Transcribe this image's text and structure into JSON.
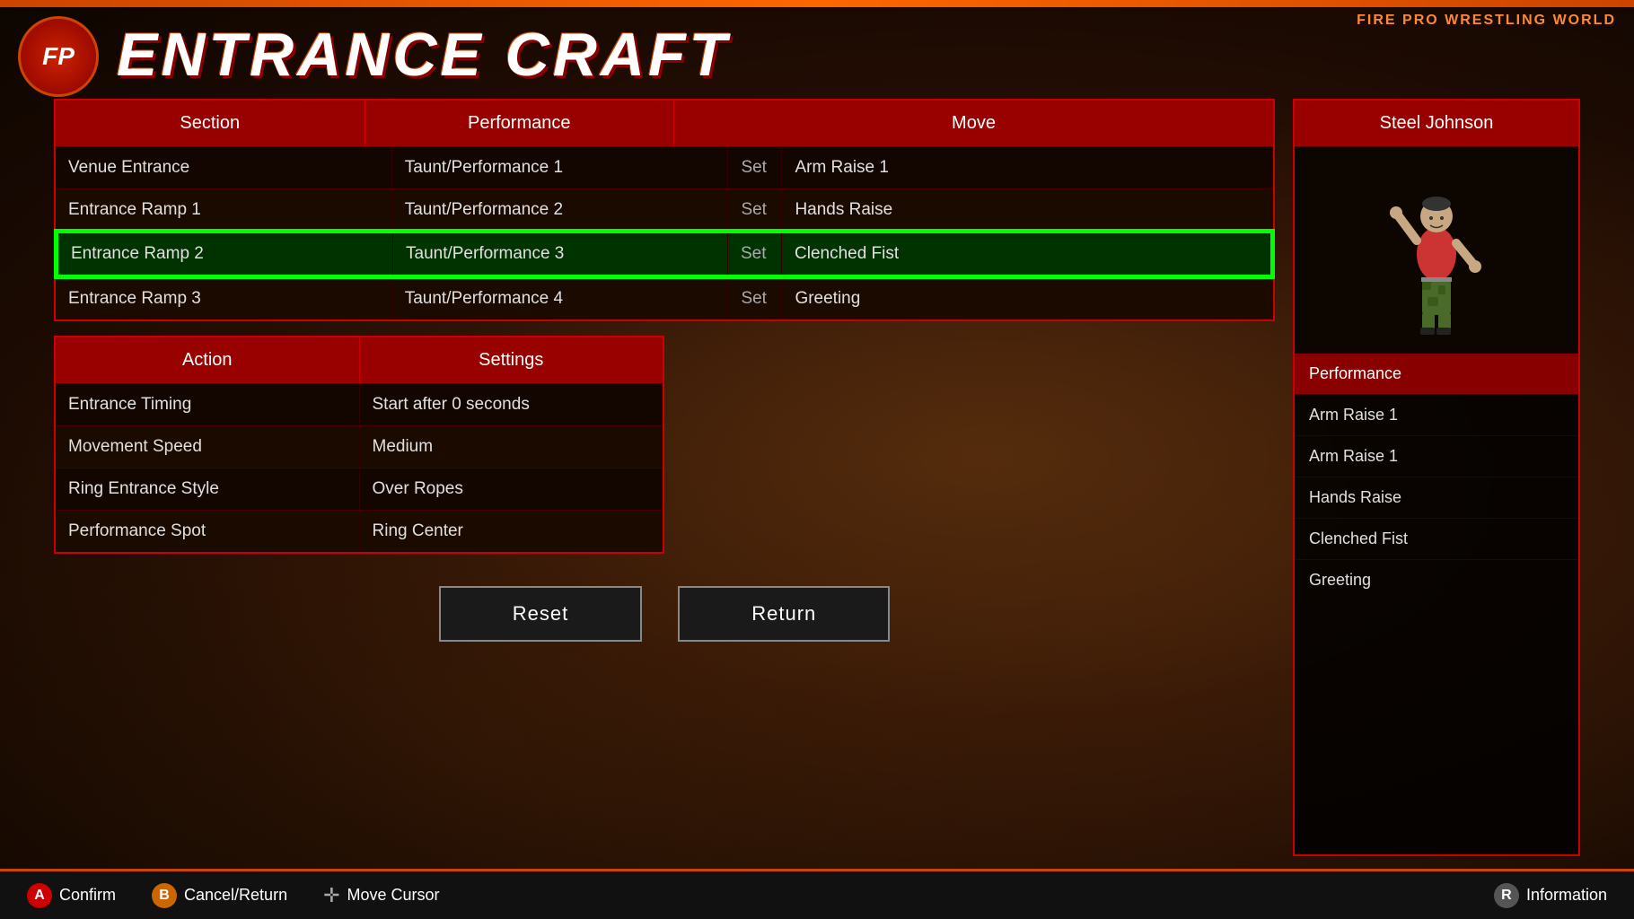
{
  "game": {
    "title": "FIRE PRO WRESTLING WORLD",
    "page_title": "ENTRANCE CRAFT",
    "logo": "FP"
  },
  "main_table": {
    "headers": [
      "Section",
      "Performance",
      "Move"
    ],
    "rows": [
      {
        "section": "Venue Entrance",
        "performance": "Taunt/Performance 1",
        "set": "Set",
        "move": "Arm Raise 1",
        "selected": false
      },
      {
        "section": "Entrance Ramp 1",
        "performance": "Taunt/Performance 2",
        "set": "Set",
        "move": "Hands Raise",
        "selected": false
      },
      {
        "section": "Entrance Ramp 2",
        "performance": "Taunt/Performance 3",
        "set": "Set",
        "move": "Clenched Fist",
        "selected": true
      },
      {
        "section": "Entrance Ramp 3",
        "performance": "Taunt/Performance 4",
        "set": "Set",
        "move": "Greeting",
        "selected": false
      }
    ]
  },
  "settings_table": {
    "headers": [
      "Action",
      "Settings"
    ],
    "rows": [
      {
        "action": "Entrance Timing",
        "setting": "Start after 0 seconds"
      },
      {
        "action": "Movement Speed",
        "setting": "Medium"
      },
      {
        "action": "Ring Entrance Style",
        "setting": "Over Ropes"
      },
      {
        "action": "Performance Spot",
        "setting": "Ring Center"
      }
    ]
  },
  "right_panel": {
    "title": "Steel Johnson",
    "section_label": "Performance",
    "items": [
      {
        "label": "Arm Raise 1",
        "highlighted": false
      },
      {
        "label": "Arm Raise 1",
        "highlighted": false
      },
      {
        "label": "Hands Raise",
        "highlighted": false
      },
      {
        "label": "Clenched Fist",
        "highlighted": false
      },
      {
        "label": "Greeting",
        "highlighted": false
      }
    ]
  },
  "buttons": {
    "reset": "Reset",
    "return": "Return"
  },
  "bottom_hints": [
    {
      "btn": "A",
      "label": "Confirm",
      "type": "a"
    },
    {
      "btn": "B",
      "label": "Cancel/Return",
      "type": "b"
    },
    {
      "btn": "✛",
      "label": "Move Cursor",
      "type": "dpad"
    },
    {
      "btn": "R",
      "label": "Information",
      "type": "r"
    }
  ]
}
